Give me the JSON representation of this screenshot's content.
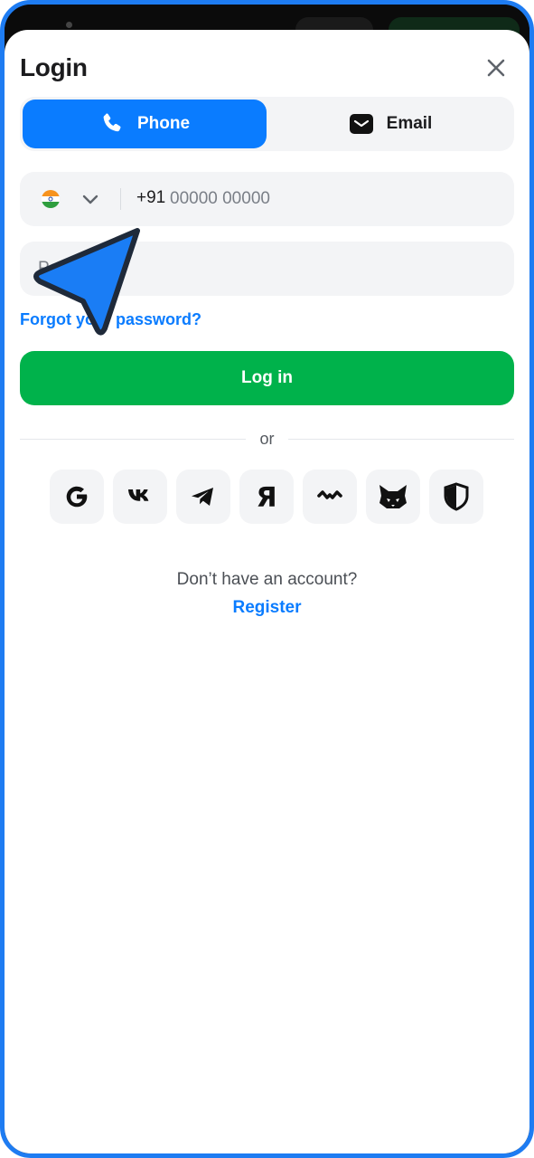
{
  "header": {
    "title": "Login"
  },
  "tabs": [
    {
      "label": "Phone",
      "icon": "phone-icon",
      "active": true
    },
    {
      "label": "Email",
      "icon": "mail-icon",
      "active": false
    }
  ],
  "phone": {
    "country": "India",
    "flag_icon": "india-flag-icon",
    "code": "+91",
    "placeholder": "00000 00000"
  },
  "password": {
    "placeholder": "Password"
  },
  "links": {
    "forgot": "Forgot your password?"
  },
  "buttons": {
    "login": "Log in"
  },
  "divider": {
    "text": "or"
  },
  "socials": [
    {
      "icon": "google-icon"
    },
    {
      "icon": "vk-icon"
    },
    {
      "icon": "telegram-icon"
    },
    {
      "icon": "yandex-icon"
    },
    {
      "icon": "walletconnect-icon"
    },
    {
      "icon": "metamask-icon"
    },
    {
      "icon": "shield-icon"
    }
  ],
  "footer": {
    "prompt": "Don’t have an account?",
    "register": "Register"
  },
  "colors": {
    "accent": "#0a7cff",
    "login": "#00b24b",
    "frame": "#1e7cf2"
  }
}
